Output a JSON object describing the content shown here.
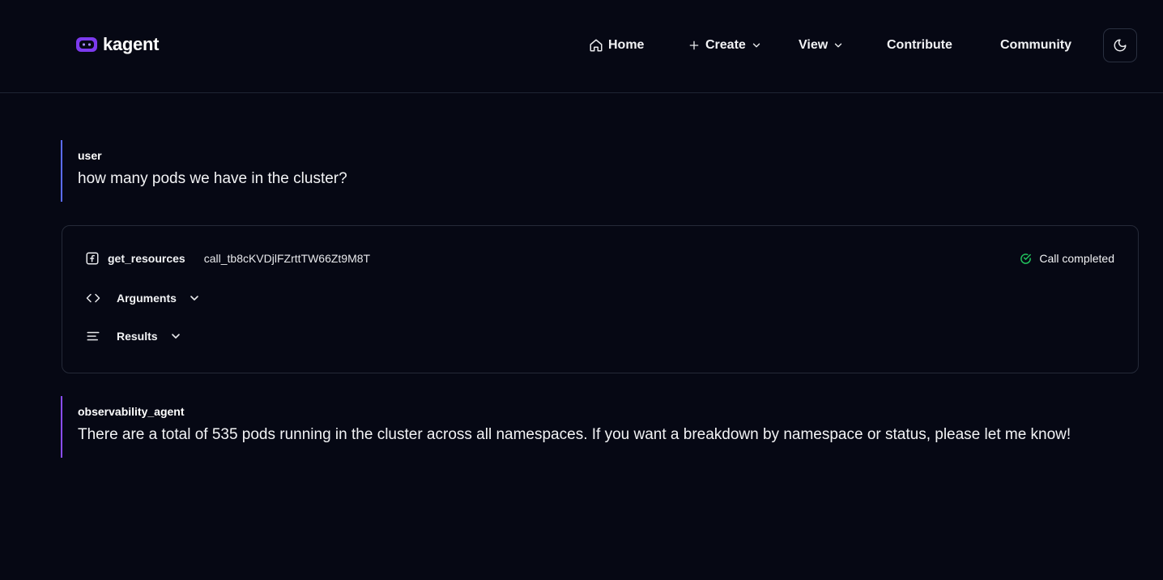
{
  "brand": {
    "name": "kagent",
    "accent_color": "#7c3aed"
  },
  "nav": {
    "home": "Home",
    "create": "Create",
    "view": "View",
    "contribute": "Contribute",
    "community": "Community",
    "theme_toggle_icon": "moon-icon"
  },
  "messages": {
    "user": {
      "author": "user",
      "text": "how many pods we have in the cluster?"
    },
    "agent": {
      "author": "observability_agent",
      "text": "There are a total of 535 pods running in the cluster across all namespaces. If you want a breakdown by namespace or status, please let me know!"
    }
  },
  "tool_call": {
    "name": "get_resources",
    "call_id": "call_tb8cKVDjlFZrttTW66Zt9M8T",
    "status": "Call completed",
    "status_color": "#22c55e",
    "arguments_label": "Arguments",
    "results_label": "Results"
  },
  "colors": {
    "background": "#060814",
    "user_border": "#5b6cff",
    "agent_border": "#8a4dff"
  }
}
